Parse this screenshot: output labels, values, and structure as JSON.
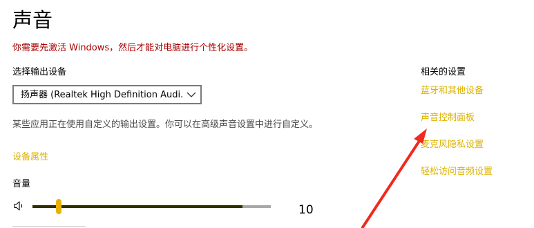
{
  "page": {
    "title": "声音",
    "activation_warning": "你需要先激活 Windows，然后才能对电脑进行个性化设置。"
  },
  "output": {
    "label": "选择输出设备",
    "selected_device": "扬声器 (Realtek High Definition Audi...",
    "help_text": "某些应用正在使用自定义的输出设置。你可以在高级声音设置中进行自定义。",
    "device_properties_link": "设备属性"
  },
  "volume": {
    "label": "音量",
    "value": "10",
    "level_fraction": 0.88,
    "thumb_fraction": 0.11,
    "icon": "speaker-icon"
  },
  "related": {
    "title": "相关的设置",
    "links": [
      "蓝牙和其他设备",
      "声音控制面板",
      "麦克风隐私设置",
      "轻松访问音频设置"
    ]
  },
  "colors": {
    "link": "#ddb200",
    "warning": "#a80000",
    "slider_thumb": "#e8b300",
    "slider_fill": "#2f2f00",
    "annotation_arrow": "#f02a1c"
  }
}
